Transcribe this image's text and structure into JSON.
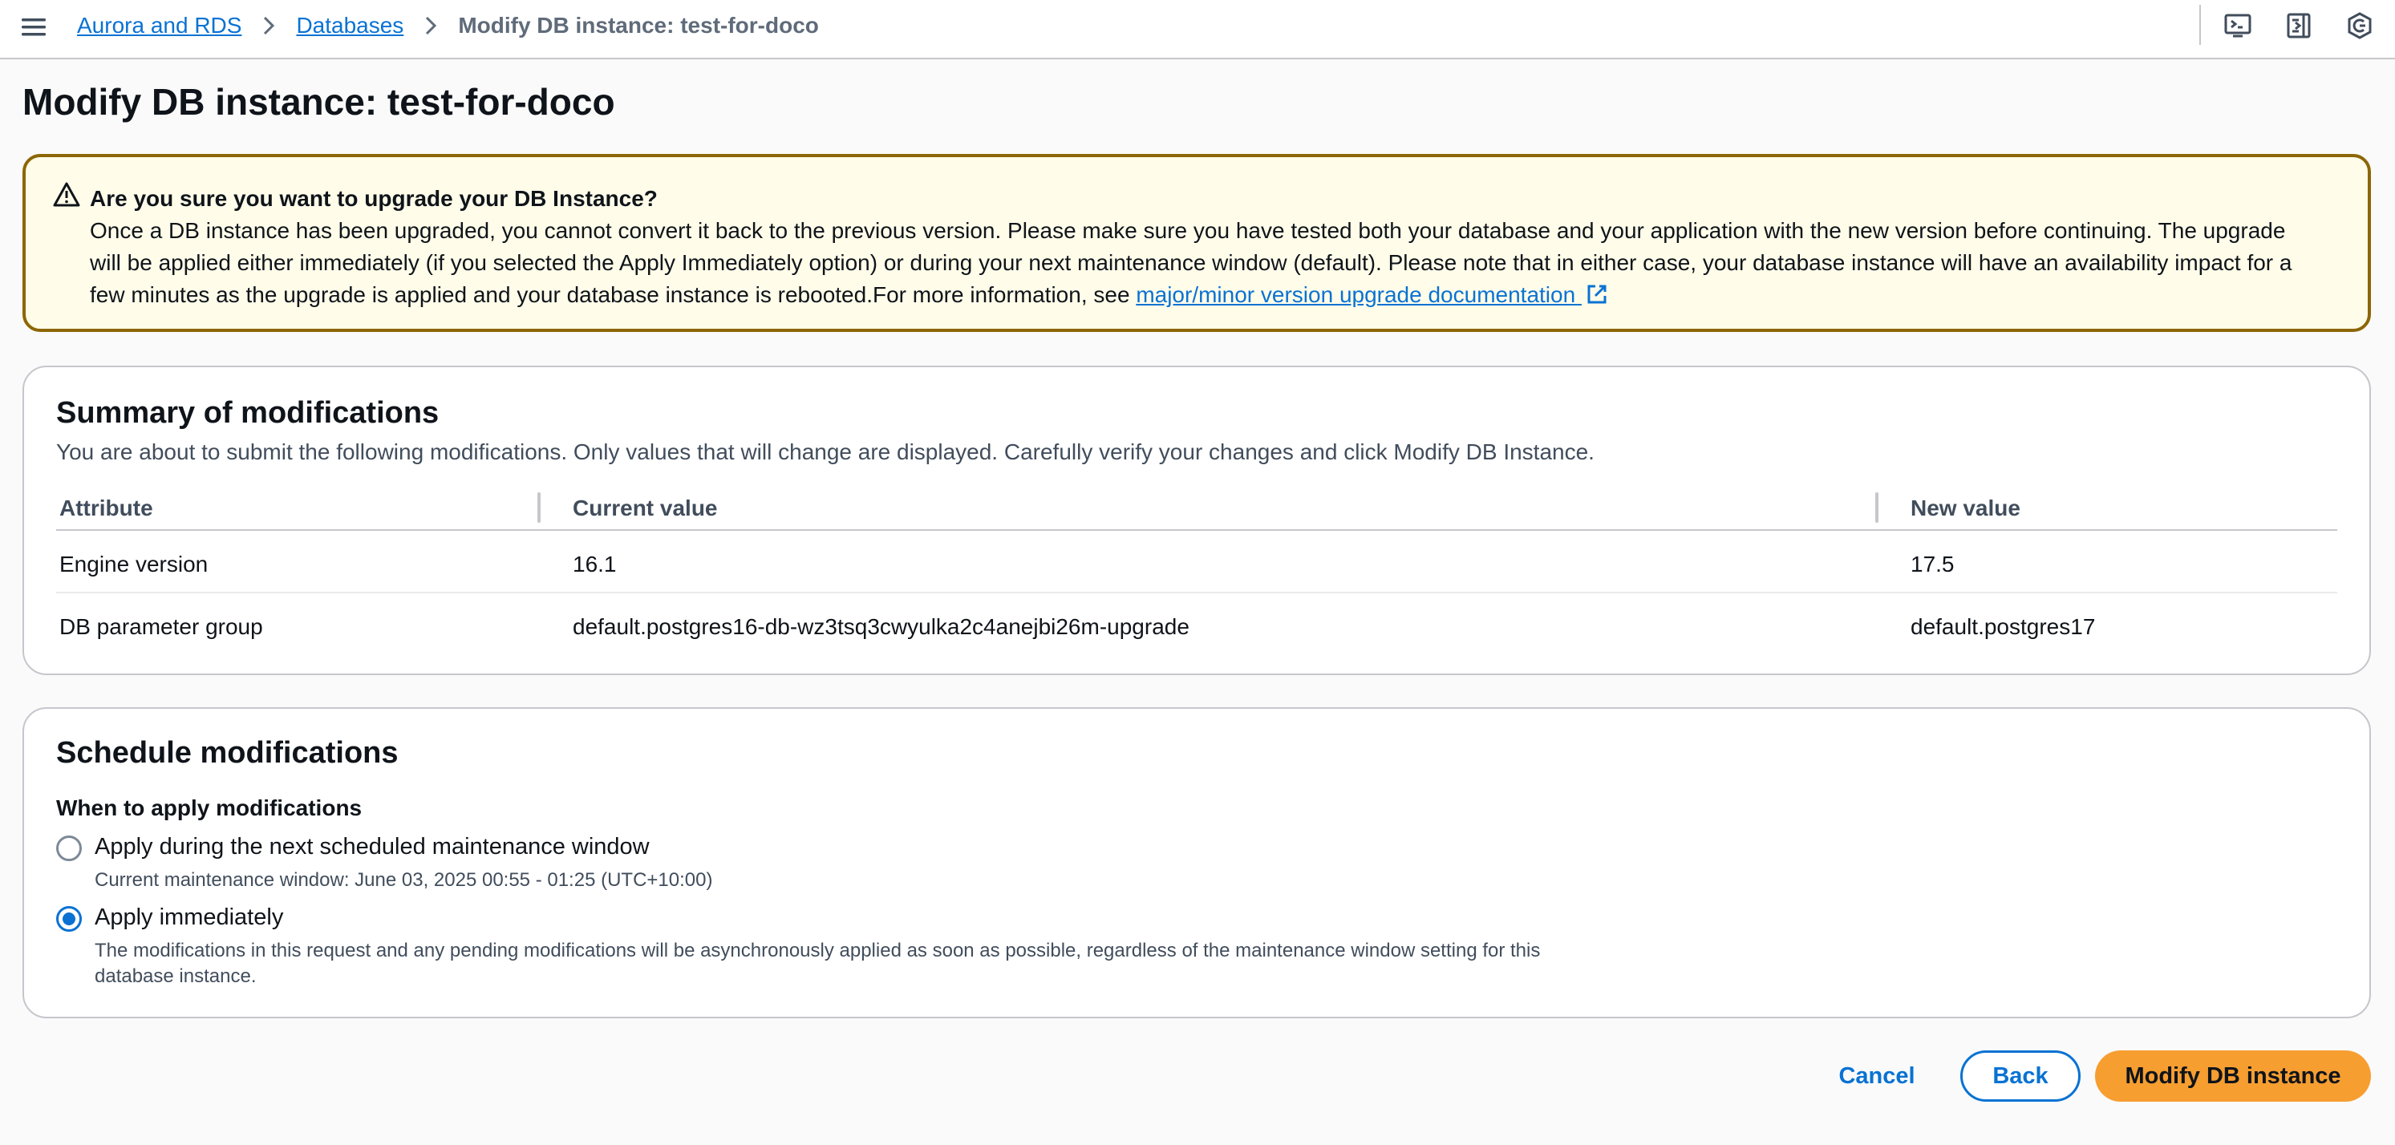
{
  "breadcrumb": {
    "items": [
      {
        "label": "Aurora and RDS"
      },
      {
        "label": "Databases"
      },
      {
        "label": "Modify DB instance: test-for-doco"
      }
    ]
  },
  "page_title": "Modify DB instance: test-for-doco",
  "alert": {
    "type": "warning",
    "heading": "Are you sure you want to upgrade your DB Instance?",
    "body": "Once a DB instance has been upgraded, you cannot convert it back to the previous version. Please make sure you have tested both your database and your application with the new version before continuing. The upgrade will be applied either immediately (if you selected the Apply Immediately option) or during your next maintenance window (default). Please note that in either case, your database instance will have an availability impact for a few minutes as the upgrade is applied and your database instance is rebooted.For more information, see ",
    "link_text": "major/minor version upgrade documentation "
  },
  "summary": {
    "title": "Summary of modifications",
    "description": "You are about to submit the following modifications. Only values that will change are displayed. Carefully verify your changes and click Modify DB Instance.",
    "columns": [
      "Attribute",
      "Current value",
      "New value"
    ],
    "rows": [
      [
        "Engine version",
        "16.1",
        "17.5"
      ],
      [
        "DB parameter group",
        "default.postgres16-db-wz3tsq3cwyulka2c4anejbi26m-upgrade",
        "default.postgres17"
      ]
    ]
  },
  "schedule": {
    "title": "Schedule modifications",
    "field_label": "When to apply modifications",
    "options": [
      {
        "label": "Apply during the next scheduled maintenance window",
        "description": "Current maintenance window: June 03, 2025 00:55 - 01:25 (UTC+10:00)",
        "selected": false
      },
      {
        "label": "Apply immediately",
        "description": "The modifications in this request and any pending modifications will be asynchronously applied as soon as possible, regardless of the maintenance window setting for this database instance.",
        "selected": true
      }
    ]
  },
  "footer": {
    "cancel_label": "Cancel",
    "back_label": "Back",
    "submit_label": "Modify DB instance"
  },
  "colors": {
    "link": "#0972d3",
    "primary_button": "#f79e31",
    "warning_border": "#8d6605",
    "warning_background": "#fffce9"
  },
  "icons": {
    "menu": "hamburger-menu-icon",
    "breadcrumb_separator": "chevron-right-icon",
    "toolbar": [
      "cloudshell-icon",
      "side-panel-icon",
      "notifications-settings-icon"
    ],
    "alert": "warning-triangle-icon",
    "external_link": "external-link-icon"
  }
}
